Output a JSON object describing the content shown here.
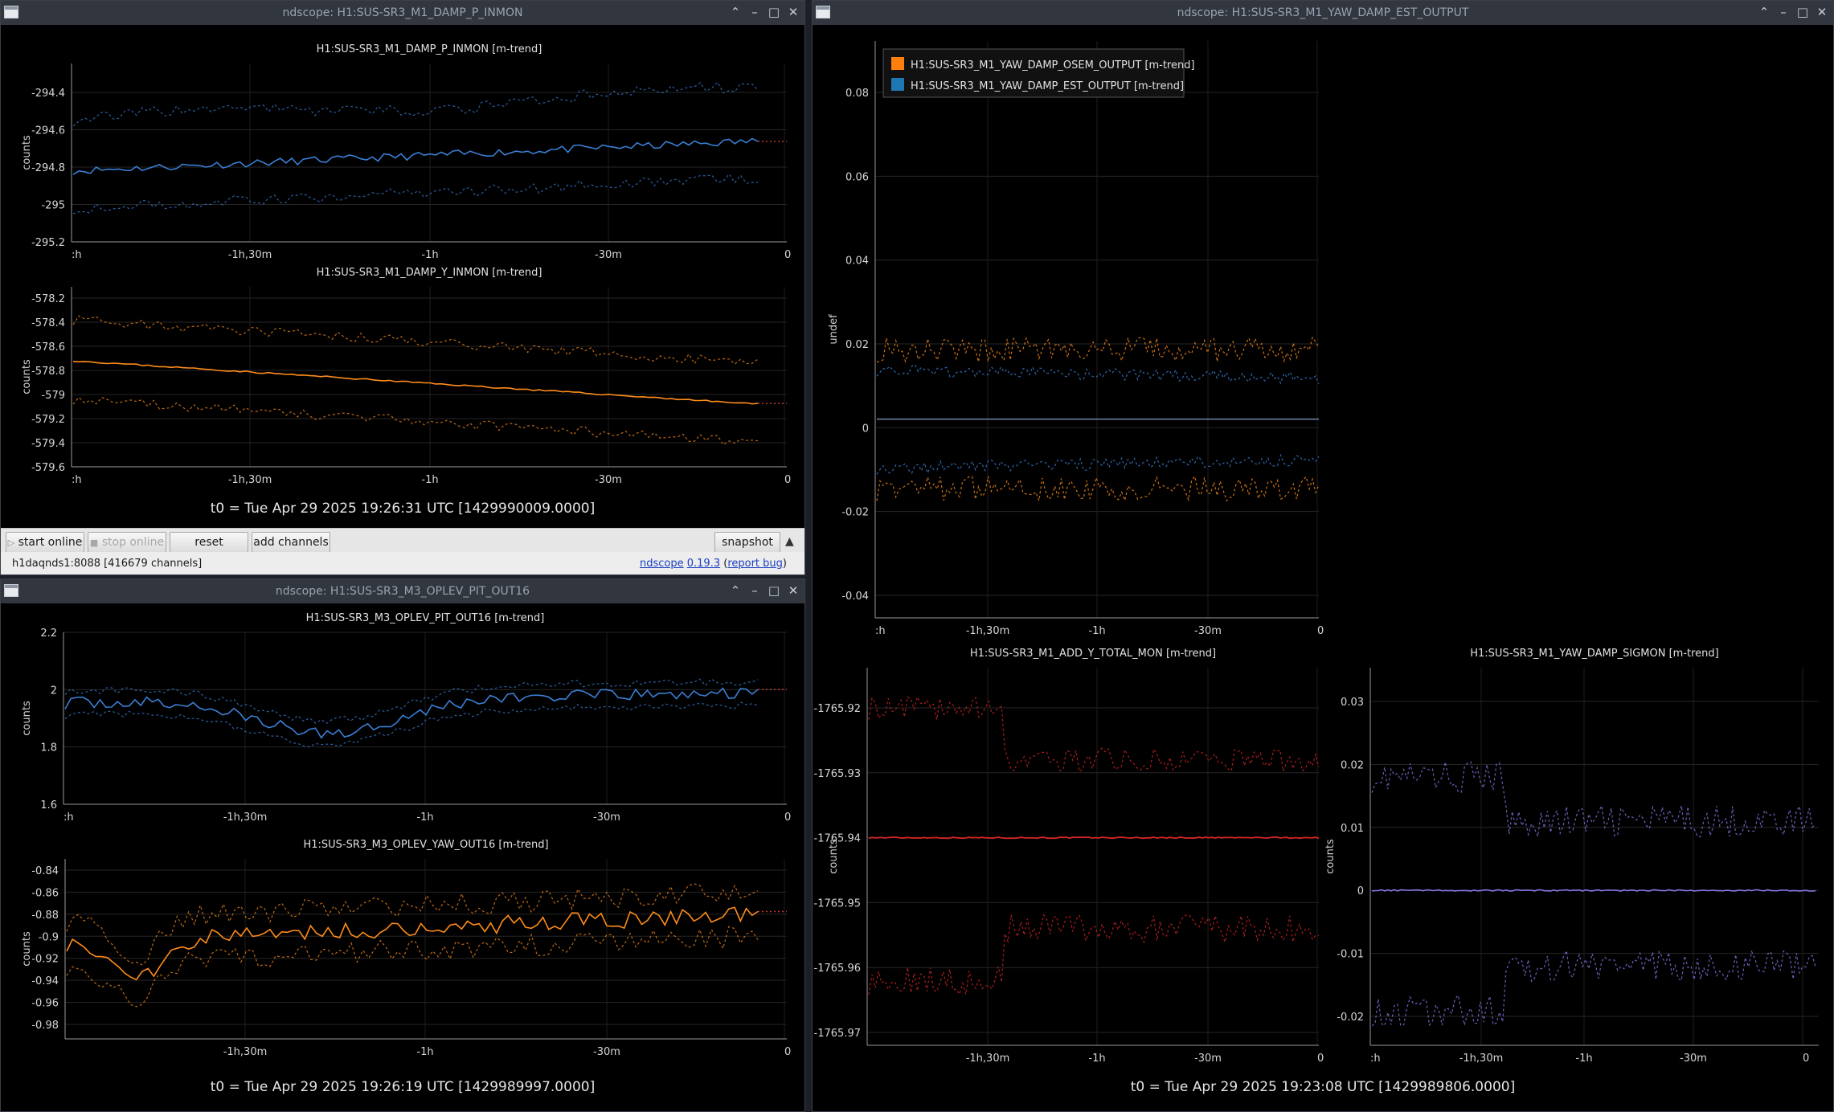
{
  "colors": {
    "blue": "#3a7fd4",
    "orange": "#ff8c1a",
    "red": "#d42424",
    "purple": "#8878e8",
    "legend_orange": "#ff7f0e",
    "legend_blue": "#1f77b4"
  },
  "win1": {
    "title": "ndscope: H1:SUS-SR3_M1_DAMP_P_INMON",
    "t0": "t0 = Tue Apr 29 2025 19:26:31 UTC [1429990009.0000]",
    "controls": {
      "start_online": "start online",
      "stop_online": "stop online",
      "reset": "reset",
      "add_channels": "add channels",
      "snapshot": "snapshot",
      "expand_icon": "▲"
    },
    "status": {
      "server": "h1daqnds1:8088  [416679 channels]",
      "app": "ndscope",
      "version": "0.19.3",
      "report_open": "(",
      "report_bug": "report bug",
      "report_close": ")"
    },
    "plots": [
      {
        "title": "H1:SUS-SR3_M1_DAMP_P_INMON [m-trend]",
        "ylabel": "counts",
        "yticks": [
          "-294.4",
          "-294.6",
          "-294.8",
          "-295",
          "-295.2"
        ],
        "xticks": [
          ":h",
          "-1h,30m",
          "-1h",
          "-30m",
          "0"
        ]
      },
      {
        "title": "H1:SUS-SR3_M1_DAMP_Y_INMON [m-trend]",
        "ylabel": "counts",
        "yticks": [
          "-578.2",
          "-578.4",
          "-578.6",
          "-578.8",
          "-579",
          "-579.2",
          "-579.4",
          "-579.6"
        ],
        "xticks": [
          ":h",
          "-1h,30m",
          "-1h",
          "-30m",
          "0"
        ]
      }
    ]
  },
  "win2": {
    "title": "ndscope: H1:SUS-SR3_M3_OPLEV_PIT_OUT16",
    "t0": "t0 = Tue Apr 29 2025 19:26:19 UTC [1429989997.0000]",
    "plots": [
      {
        "title": "H1:SUS-SR3_M3_OPLEV_PIT_OUT16 [m-trend]",
        "ylabel": "counts",
        "yticks": [
          "2.2",
          "2",
          "1.8",
          "1.6"
        ],
        "xticks": [
          ":h",
          "-1h,30m",
          "-1h",
          "-30m",
          "0"
        ]
      },
      {
        "title": "H1:SUS-SR3_M3_OPLEV_YAW_OUT16 [m-trend]",
        "ylabel": "counts",
        "yticks": [
          "-0.84",
          "-0.86",
          "-0.88",
          "-0.9",
          "-0.92",
          "-0.94",
          "-0.96",
          "-0.98"
        ],
        "xticks": [
          "-1h,30m",
          "-1h",
          "-30m",
          "0"
        ]
      }
    ]
  },
  "win3": {
    "title": "ndscope: H1:SUS-SR3_M1_YAW_DAMP_EST_OUTPUT",
    "t0": "t0 = Tue Apr 29 2025 19:23:08 UTC [1429989806.0000]",
    "plots": [
      {
        "title": "",
        "ylabel": "undef",
        "yticks": [
          "0.08",
          "0.06",
          "0.04",
          "0.02",
          "0",
          "-0.02",
          "-0.04"
        ],
        "xticks": [
          ":h",
          "-1h,30m",
          "-1h",
          "-30m",
          "0"
        ],
        "legend": [
          "H1:SUS-SR3_M1_YAW_DAMP_OSEM_OUTPUT [m-trend]",
          "H1:SUS-SR3_M1_YAW_DAMP_EST_OUTPUT [m-trend]"
        ]
      },
      {
        "title": "H1:SUS-SR3_M1_ADD_Y_TOTAL_MON [m-trend]",
        "ylabel": "counts",
        "yticks": [
          "-1765.92",
          "-1765.93",
          "-1765.94",
          "-1765.95",
          "-1765.96",
          "-1765.97"
        ],
        "xticks": [
          "-1h,30m",
          "-1h",
          "-30m",
          "0"
        ]
      },
      {
        "title": "H1:SUS-SR3_M1_YAW_DAMP_SIGMON [m-trend]",
        "ylabel": "counts",
        "yticks": [
          "0.03",
          "0.02",
          "0.01",
          "0",
          "-0.01",
          "-0.02"
        ],
        "xticks": [
          ":h",
          "-1h,30m",
          "-1h",
          "-30m",
          "0"
        ]
      }
    ]
  }
}
